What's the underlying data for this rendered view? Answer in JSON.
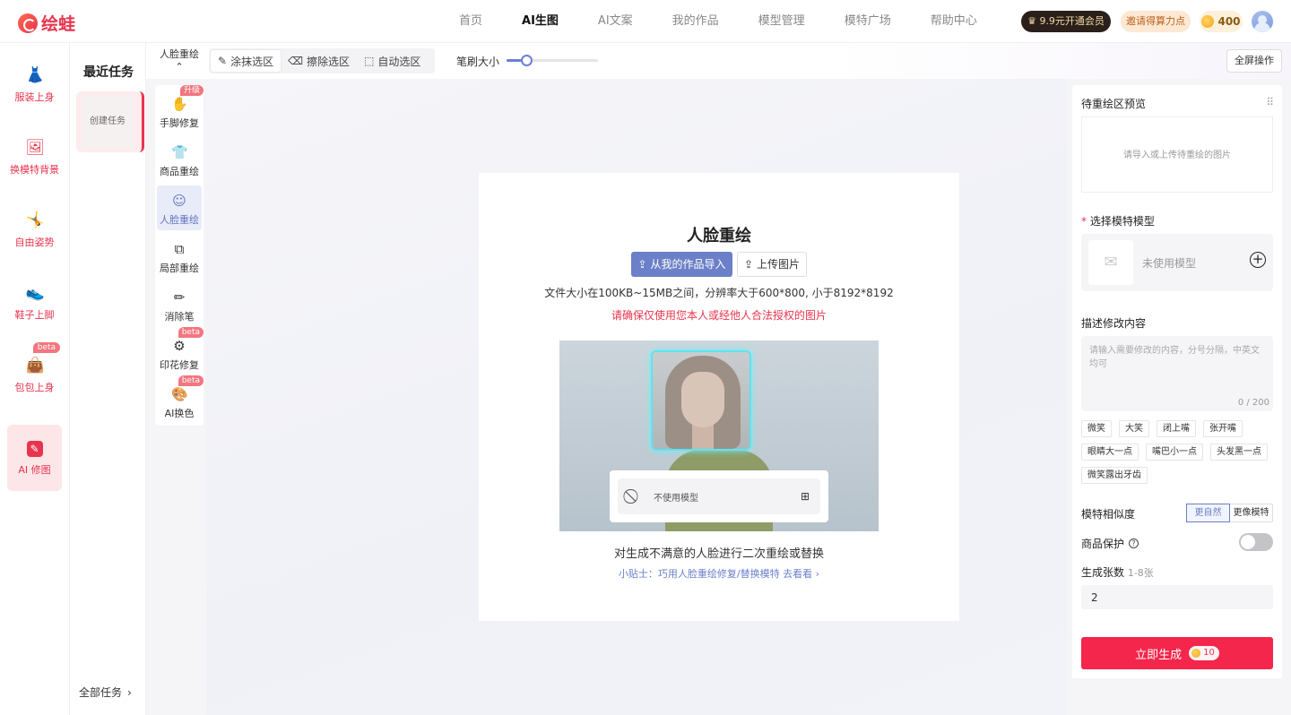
{
  "brand": {
    "logo_text": "绘蛙"
  },
  "nav": [
    {
      "label": "首页",
      "active": false
    },
    {
      "label": "AI生图",
      "active": true
    },
    {
      "label": "AI文案",
      "active": false
    },
    {
      "label": "我的作品",
      "active": false
    },
    {
      "label": "模型管理",
      "active": false
    },
    {
      "label": "模特广场",
      "active": false
    },
    {
      "label": "帮助中心",
      "active": false
    }
  ],
  "header": {
    "vip_label": "9.9元开通会员",
    "invite_label": "邀请得算力点",
    "coins": "400"
  },
  "sidebar": {
    "items": [
      {
        "label": "服装上身",
        "icon": "dress-icon",
        "glyph": "👗"
      },
      {
        "label": "换模特背景",
        "icon": "portrait-icon",
        "glyph": "🖼"
      },
      {
        "label": "自由姿势",
        "icon": "pose-icon",
        "glyph": "🤸"
      },
      {
        "label": "鞋子上脚",
        "icon": "shoe-icon",
        "glyph": "👟"
      },
      {
        "label": "包包上身",
        "icon": "bag-icon",
        "glyph": "👜",
        "badge": "beta"
      },
      {
        "label": "AI 修图",
        "icon": "ai-retouch-icon",
        "glyph": "✎",
        "active": true
      }
    ]
  },
  "recent": {
    "title": "最近任务",
    "create_label": "创建任务",
    "all_tasks_label": "全部任务"
  },
  "toolbar": {
    "mode_label": "人脸重绘",
    "tools": [
      {
        "label": "涂抹选区",
        "icon": "pen-icon",
        "glyph": "✎",
        "active": true
      },
      {
        "label": "擦除选区",
        "icon": "eraser-icon",
        "glyph": "⌫",
        "active": false
      },
      {
        "label": "自动选区",
        "icon": "auto-select-icon",
        "glyph": "⬚",
        "active": false
      }
    ],
    "brush_label": "笔刷大小",
    "brush_level": 0.22,
    "fullscreen_label": "全屏操作"
  },
  "tool_column": [
    {
      "label": "手脚修复",
      "icon": "hand-icon",
      "glyph": "✋",
      "badge": "升级"
    },
    {
      "label": "商品重绘",
      "icon": "shirt-icon",
      "glyph": "👕"
    },
    {
      "label": "人脸重绘",
      "icon": "face-icon",
      "glyph": "☺",
      "active": true
    },
    {
      "label": "局部重绘",
      "icon": "local-redraw-icon",
      "glyph": "⧉"
    },
    {
      "label": "消除笔",
      "icon": "eraser-pen-icon",
      "glyph": "✏"
    },
    {
      "label": "印花修复",
      "icon": "gear-icon",
      "glyph": "⚙",
      "badge": "beta"
    },
    {
      "label": "AI换色",
      "icon": "palette-icon",
      "glyph": "🎨",
      "badge": "beta"
    }
  ],
  "card": {
    "title": "人脸重绘",
    "import_label": "从我的作品导入",
    "upload_label": "上传图片",
    "file_hint": "文件大小在100KB~15MB之间，分辨率大于600*800, 小于8192*8192",
    "legal_hint": "请确保仅使用您本人或经他人合法授权的图片",
    "demo_panel_text": "不使用模型",
    "description": "对生成不满意的人脸进行二次重绘或替换",
    "tip": "小贴士：巧用人脸重绘修复/替换模特 去看看"
  },
  "right_panel": {
    "preview_title": "待重绘区预览",
    "preview_placeholder": "请导入或上传待重绘的图片",
    "model_title": "选择模特模型",
    "model_placeholder": "未使用模型",
    "desc_title": "描述修改内容",
    "desc_placeholder": "请输入需要修改的内容，分号分隔，中英文均可",
    "desc_count": "0 / 200",
    "tags": [
      "微笑",
      "大笑",
      "闭上嘴",
      "张开嘴",
      "眼睛大一点",
      "嘴巴小一点",
      "头发黑一点",
      "微笑露出牙齿"
    ],
    "similarity_label": "模特相似度",
    "similarity_options": [
      {
        "label": "更自然",
        "active": true
      },
      {
        "label": "更像模特",
        "active": false
      }
    ],
    "protect_label": "商品保护",
    "protect_enabled": false,
    "count_label": "生成张数",
    "count_range": "1-8张",
    "count_value": "2",
    "generate_label": "立即生成",
    "generate_cost": "10"
  },
  "colors": {
    "accent": "#e8344e",
    "primary_blue": "#6b80c8",
    "generate_red": "#f5264b"
  }
}
